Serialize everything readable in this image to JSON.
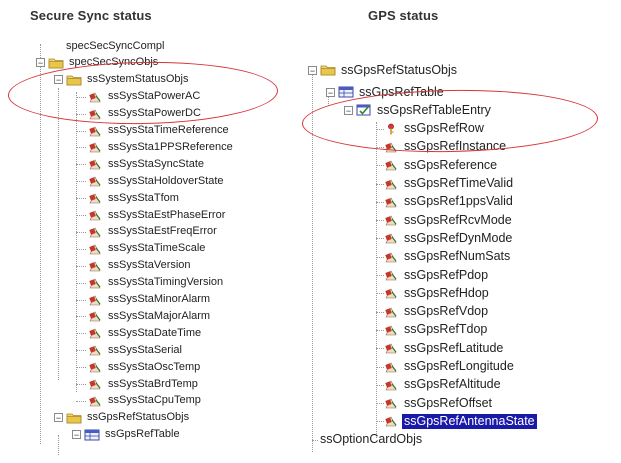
{
  "captions": {
    "left": "Secure Sync status",
    "right": "GPS status"
  },
  "left_tree": [
    {
      "label": "specSecSyncCompl",
      "kind": "text"
    },
    {
      "label": "specSecSyncObjs",
      "kind": "folder"
    },
    {
      "label": "ssSystemStatusObjs",
      "kind": "folder"
    },
    {
      "label": "ssSysStaPowerAC",
      "kind": "leaf"
    },
    {
      "label": "ssSysStaPowerDC",
      "kind": "leaf"
    },
    {
      "label": "ssSysStaTimeReference",
      "kind": "leaf"
    },
    {
      "label": "ssSysSta1PPSReference",
      "kind": "leaf"
    },
    {
      "label": "ssSysStaSyncState",
      "kind": "leaf"
    },
    {
      "label": "ssSysStaHoldoverState",
      "kind": "leaf"
    },
    {
      "label": "ssSysStaTfom",
      "kind": "leaf"
    },
    {
      "label": "ssSysStaEstPhaseError",
      "kind": "leaf"
    },
    {
      "label": "ssSysStaEstFreqError",
      "kind": "leaf"
    },
    {
      "label": "ssSysStaTimeScale",
      "kind": "leaf"
    },
    {
      "label": "ssSysStaVersion",
      "kind": "leaf"
    },
    {
      "label": "ssSysStaTimingVersion",
      "kind": "leaf"
    },
    {
      "label": "ssSysStaMinorAlarm",
      "kind": "leaf"
    },
    {
      "label": "ssSysStaMajorAlarm",
      "kind": "leaf"
    },
    {
      "label": "ssSysStaDateTime",
      "kind": "leaf"
    },
    {
      "label": "ssSysStaSerial",
      "kind": "leaf"
    },
    {
      "label": "ssSysStaOscTemp",
      "kind": "leaf"
    },
    {
      "label": "ssSysStaBrdTemp",
      "kind": "leaf"
    },
    {
      "label": "ssSysStaCpuTemp",
      "kind": "leaf"
    },
    {
      "label": "ssGpsRefStatusObjs",
      "kind": "folder"
    },
    {
      "label": "ssGpsRefTable",
      "kind": "table"
    }
  ],
  "right_tree": [
    {
      "label": "ssGpsRefStatusObjs",
      "kind": "folder"
    },
    {
      "label": "ssGpsRefTable",
      "kind": "table"
    },
    {
      "label": "ssGpsRefTableEntry",
      "kind": "entry"
    },
    {
      "label": "ssGpsRefRow",
      "kind": "key"
    },
    {
      "label": "ssGpsRefInstance",
      "kind": "leaf"
    },
    {
      "label": "ssGpsReference",
      "kind": "leaf"
    },
    {
      "label": "ssGpsRefTimeValid",
      "kind": "leaf"
    },
    {
      "label": "ssGpsRef1ppsValid",
      "kind": "leaf"
    },
    {
      "label": "ssGpsRefRcvMode",
      "kind": "leaf"
    },
    {
      "label": "ssGpsRefDynMode",
      "kind": "leaf"
    },
    {
      "label": "ssGpsRefNumSats",
      "kind": "leaf"
    },
    {
      "label": "ssGpsRefPdop",
      "kind": "leaf"
    },
    {
      "label": "ssGpsRefHdop",
      "kind": "leaf"
    },
    {
      "label": "ssGpsRefVdop",
      "kind": "leaf"
    },
    {
      "label": "ssGpsRefTdop",
      "kind": "leaf"
    },
    {
      "label": "ssGpsRefLatitude",
      "kind": "leaf"
    },
    {
      "label": "ssGpsRefLongitude",
      "kind": "leaf"
    },
    {
      "label": "ssGpsRefAltitude",
      "kind": "leaf"
    },
    {
      "label": "ssGpsRefOffset",
      "kind": "leaf"
    },
    {
      "label": "ssGpsRefAntennaState",
      "kind": "leaf",
      "selected": true
    },
    {
      "label": "ssOptionCardObjs",
      "kind": "text"
    }
  ],
  "colors": {
    "selection": "#1a1aa8",
    "annotation": "#d8343a",
    "folder": "#e8c64a",
    "leaf_accent": "#c0392b"
  }
}
